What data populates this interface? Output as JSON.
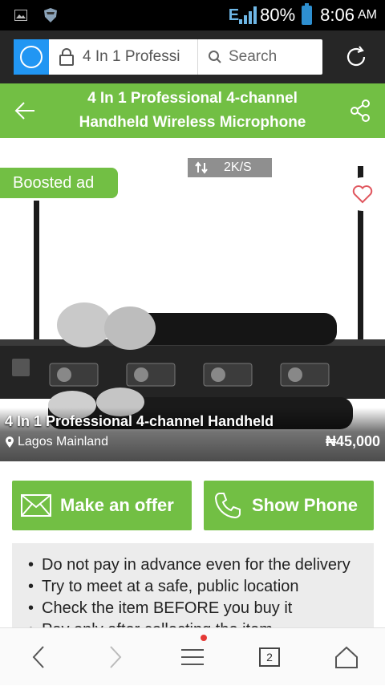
{
  "status_bar": {
    "network": "E",
    "battery_percent": "80%",
    "time": "8:06",
    "ampm": "AM"
  },
  "browser": {
    "url_text": "4 In 1 Professi",
    "search_label": "Search"
  },
  "header": {
    "title_line1": "4 In 1 Professional 4-channel",
    "title_line2": "Handheld Wireless Microphone"
  },
  "listing": {
    "speed_indicator": "2K/S",
    "boosted_label": "Boosted ad",
    "title": "4 In 1 Professional 4-channel Handheld",
    "location": "Lagos Mainland",
    "price": "₦45,000"
  },
  "actions": {
    "offer_label": "Make an offer",
    "phone_label": "Show Phone"
  },
  "safety_tips": [
    "Do not pay in advance even for the delivery",
    "Try to meet at a safe, public location",
    "Check the item BEFORE you buy it",
    "Pay only after collecting the item"
  ],
  "bottom_nav": {
    "tab_count": "2"
  },
  "colors": {
    "brand_green": "#72bf44",
    "browser_bar": "#262626",
    "app_icon_blue": "#2196f3"
  }
}
